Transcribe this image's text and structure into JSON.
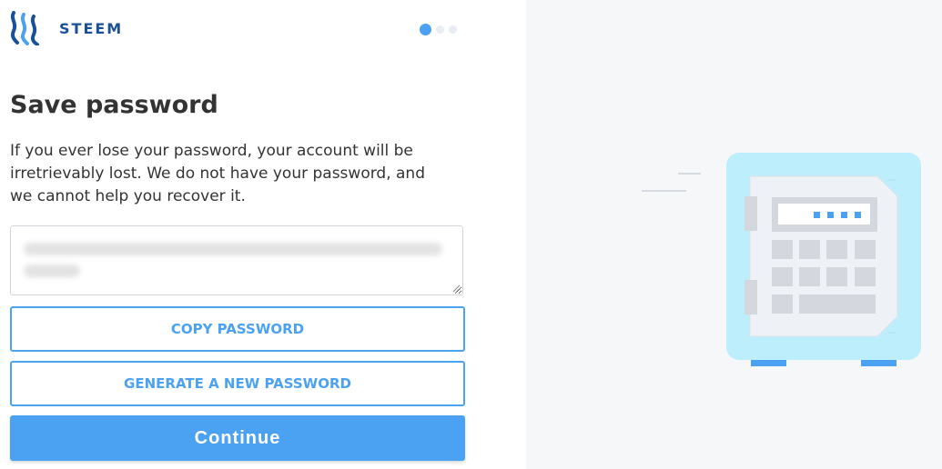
{
  "brand": {
    "name": "STEEM",
    "logo_icon": "steem-logo-icon"
  },
  "steps": {
    "total": 3,
    "current": 1
  },
  "page": {
    "title": "Save password",
    "description": "If you ever lose your password, your account will be irretrievably lost. We do not have your password, and we cannot help you recover it."
  },
  "password_field": {
    "value_obscured": true
  },
  "buttons": {
    "copy_label": "COPY PASSWORD",
    "generate_label": "GENERATE A NEW PASSWORD",
    "continue_label": "Continue"
  },
  "colors": {
    "accent": "#4ba2f2",
    "brand": "#1a5099",
    "text": "#333333",
    "right_panel_bg": "#f6f7f9",
    "safe_body": "#bdeefc"
  },
  "illustration": {
    "icon": "safe-icon"
  }
}
